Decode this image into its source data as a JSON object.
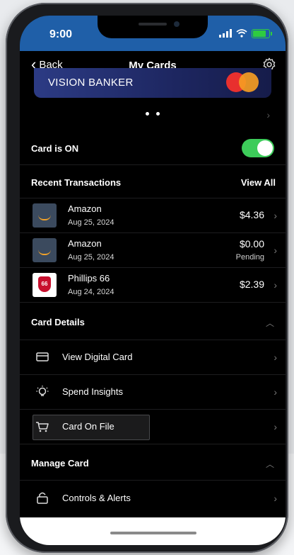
{
  "status": {
    "time": "9:00"
  },
  "nav": {
    "back_label": "Back",
    "title": "My Cards"
  },
  "card": {
    "name": "VISION BANKER"
  },
  "card_status": {
    "label": "Card is ON",
    "on": true
  },
  "transactions": {
    "header": "Recent Transactions",
    "view_all": "View All",
    "items": [
      {
        "merchant": "Amazon",
        "date": "Aug 25, 2024",
        "amount": "$4.36",
        "status": ""
      },
      {
        "merchant": "Amazon",
        "date": "Aug 25, 2024",
        "amount": "$0.00",
        "status": "Pending"
      },
      {
        "merchant": "Phillips 66",
        "date": "Aug 24, 2024",
        "amount": "$2.39",
        "status": ""
      }
    ]
  },
  "card_details": {
    "header": "Card Details",
    "items": [
      {
        "label": "View Digital Card",
        "icon": "card-icon"
      },
      {
        "label": "Spend Insights",
        "icon": "lightbulb-icon"
      },
      {
        "label": "Card On File",
        "icon": "cart-icon"
      }
    ]
  },
  "manage_card": {
    "header": "Manage Card",
    "items": [
      {
        "label": "Controls & Alerts",
        "icon": "lock-icon"
      }
    ]
  },
  "colors": {
    "status_bar": "#1f5fa8",
    "toggle_on": "#3dcc5a",
    "battery": "#2ecc40"
  }
}
